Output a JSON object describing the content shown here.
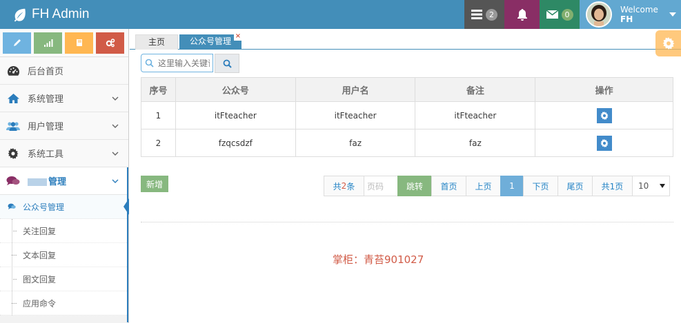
{
  "brand": {
    "title": "FH Admin"
  },
  "navbar": {
    "tasks_count": "2",
    "messages_count": "0",
    "welcome": "Welcome",
    "username": "FH"
  },
  "sidebar": {
    "items": [
      {
        "label": "后台首页",
        "icon": "dashboard-icon"
      },
      {
        "label": "系统管理",
        "icon": "home-icon"
      },
      {
        "label": "用户管理",
        "icon": "users-icon"
      },
      {
        "label": "系统工具",
        "icon": "cog-icon"
      },
      {
        "label": "管理",
        "icon": "comments-icon"
      }
    ],
    "subitems": [
      {
        "label": "公众号管理"
      },
      {
        "label": "关注回复"
      },
      {
        "label": "文本回复"
      },
      {
        "label": "图文回复"
      },
      {
        "label": "应用命令"
      }
    ]
  },
  "tabs": {
    "home": "主页",
    "active": "公众号管理",
    "close": "×"
  },
  "search": {
    "placeholder": "这里输入关键词"
  },
  "table": {
    "headers": [
      "序号",
      "公众号",
      "用户名",
      "备注",
      "操作"
    ],
    "rows": [
      [
        "1",
        "itFteacher",
        "itFteacher",
        "itFteacher"
      ],
      [
        "2",
        "fzqcsdzf",
        "faz",
        "faz"
      ]
    ]
  },
  "add_button": "新增",
  "pagination": {
    "total_prefix": "共",
    "total_num": "2",
    "total_suffix": "条",
    "page_input_placeholder": "页码",
    "jump": "跳转",
    "first": "首页",
    "prev": "上页",
    "current": "1",
    "next": "下页",
    "last": "尾页",
    "page_count": "共1页",
    "page_size": "10"
  },
  "footer_note": "掌柜：青苔901027",
  "colors": {
    "navbar": "#438eb9",
    "accent_blue": "#2b7dbc",
    "success_green": "#87b87f",
    "danger_red": "#d15b47",
    "warning_orange": "#ffb752"
  }
}
